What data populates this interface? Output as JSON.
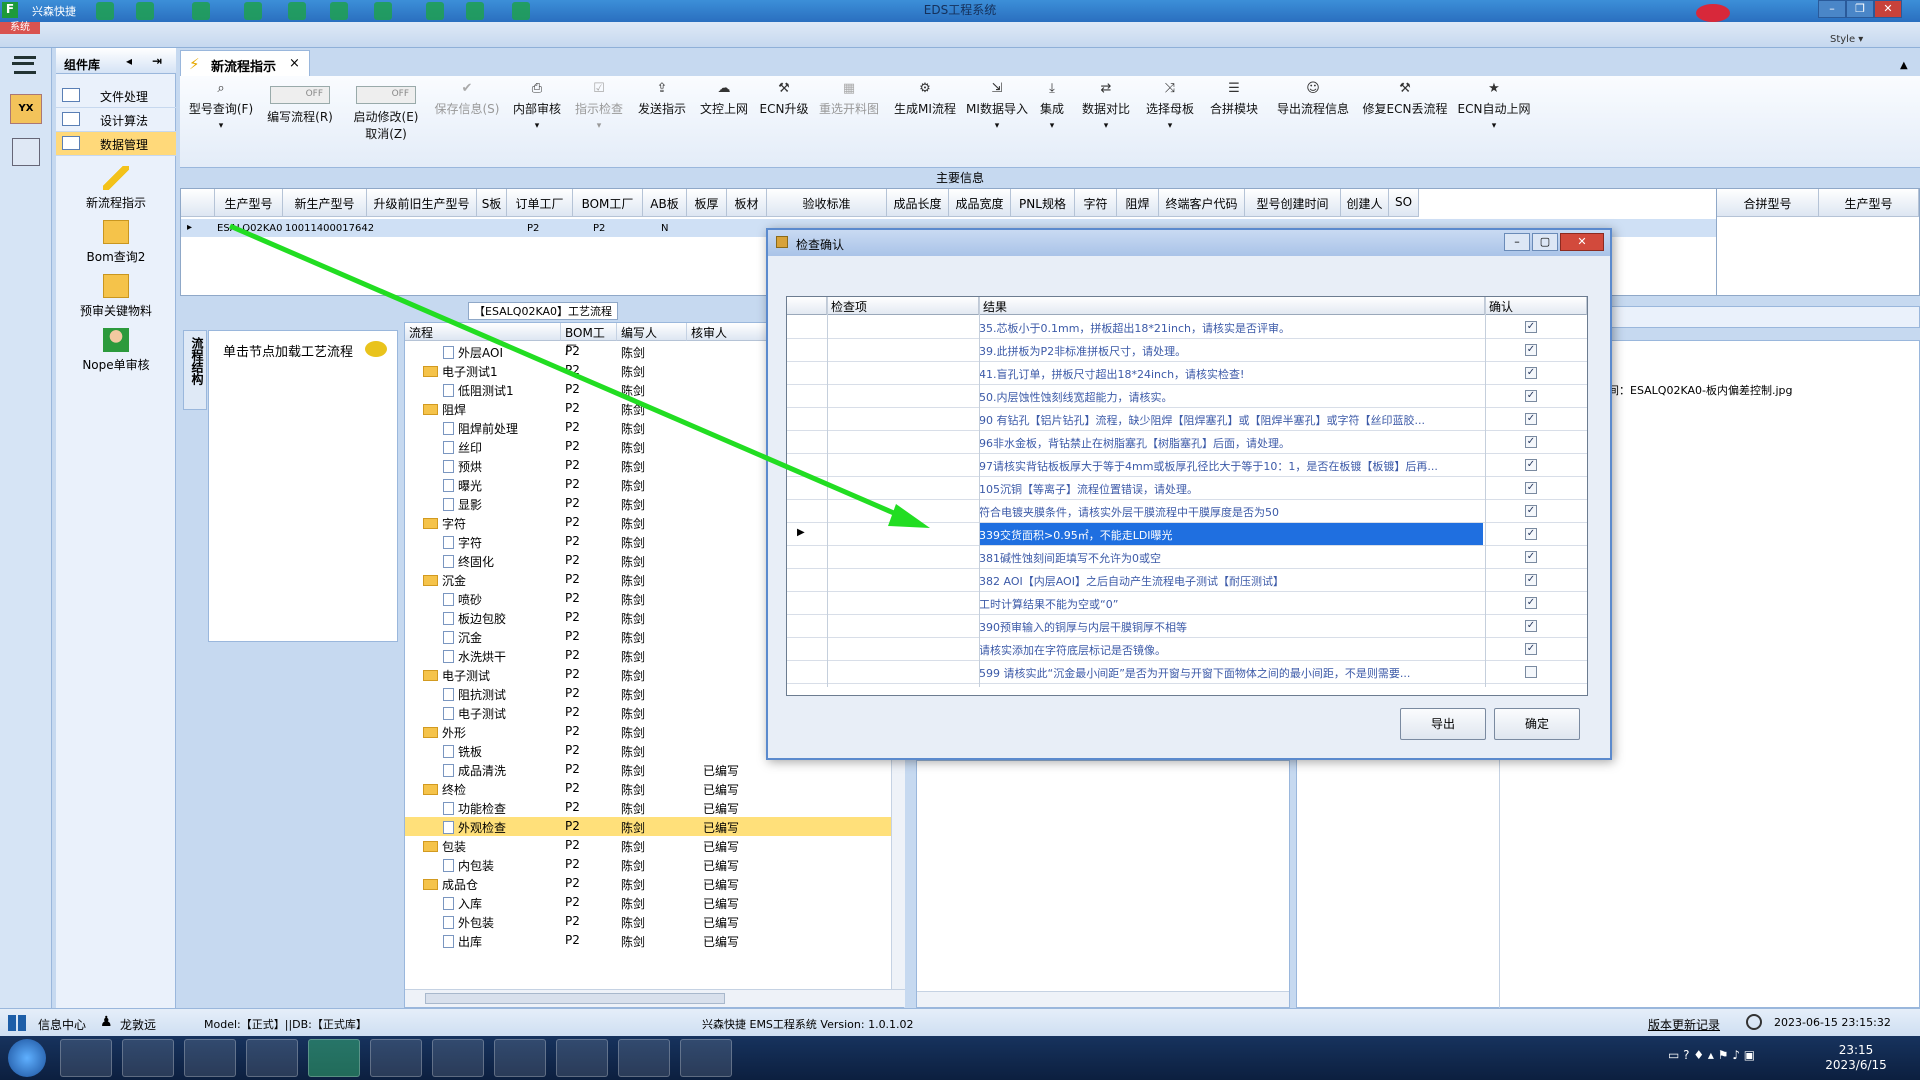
{
  "titlebar": {
    "app_name": "兴森快捷",
    "title": "EDS工程系统"
  },
  "sysbar": {
    "system_label": "系统",
    "style_label": "Style ▾"
  },
  "component_library": {
    "title": "组件库",
    "nav": [
      {
        "label": "文件处理"
      },
      {
        "label": "设计算法"
      },
      {
        "label": "数据管理"
      }
    ],
    "tools": [
      {
        "label": "新流程指示"
      },
      {
        "label": "Bom查询2"
      },
      {
        "label": "预审关键物料"
      },
      {
        "label": "Nope单审核"
      }
    ]
  },
  "doc_tab": {
    "label": "新流程指示"
  },
  "toolbar": {
    "items": [
      {
        "label": "型号查询(F)",
        "icon": "search-icon"
      },
      {
        "label": "编写流程(R)",
        "toggle": "OFF"
      },
      {
        "label": "启动修改(E)",
        "sub": "取消(Z)",
        "toggle": "OFF"
      },
      {
        "label": "保存信息(S)",
        "icon": "check-icon",
        "disabled": true
      },
      {
        "label": "内部审核",
        "icon": "print-icon"
      },
      {
        "label": "指示检查",
        "icon": "check-icon",
        "disabled": true
      },
      {
        "label": "发送指示",
        "icon": "upload-icon"
      },
      {
        "label": "文控上网",
        "icon": "cloud-icon"
      },
      {
        "label": "ECN升级",
        "icon": "wrench-icon"
      },
      {
        "label": "重选开料图",
        "icon": "image-icon",
        "disabled": true
      },
      {
        "label": "生成MI流程",
        "icon": "gear-icon"
      },
      {
        "label": "MI数据导入",
        "icon": "import-icon"
      },
      {
        "label": "集成",
        "icon": "download-icon"
      },
      {
        "label": "数据对比",
        "icon": "compare-icon"
      },
      {
        "label": "选择母板",
        "icon": "shuffle-icon"
      },
      {
        "label": "合拼模块",
        "icon": "list-icon"
      },
      {
        "label": "导出流程信息",
        "icon": "smile-icon"
      },
      {
        "label": "修复ECN丢流程",
        "icon": "hammer-icon"
      },
      {
        "label": "ECN自动上网",
        "icon": "star-icon"
      }
    ]
  },
  "main_info": {
    "title": "主要信息"
  },
  "top_grid": {
    "columns": [
      "生产型号",
      "新生产型号",
      "升级前旧生产型号",
      "S板",
      "订单工厂",
      "BOM工厂",
      "AB板",
      "板厚",
      "板材",
      "验收标准",
      "成品长度",
      "成品宽度",
      "PNL规格",
      "字符",
      "阻焊",
      "终端客户代码",
      "型号创建时间",
      "创建人",
      "SO"
    ],
    "row": {
      "prod_model": "ESALQ02KA0",
      "new_model": "10011400017642",
      "order_factory": "P2",
      "bom_factory": "P2",
      "ab": "N"
    }
  },
  "right_grid": {
    "columns": [
      "合拼型号",
      "生产型号"
    ]
  },
  "side_tab": {
    "label": "流程结构"
  },
  "node_panel": {
    "hint": "单击节点加载工艺流程"
  },
  "flow": {
    "title": "【ESALQ02KA0】工艺流程",
    "columns": [
      "流程",
      "BOM工厂",
      "编写人",
      "核审人",
      ""
    ],
    "rows": [
      {
        "name": "外层AOI",
        "level": 2,
        "bom": "P2",
        "writer": "陈剑",
        "status": ""
      },
      {
        "name": "电子测试1",
        "level": 1,
        "bom": "P2",
        "writer": "陈剑",
        "status": ""
      },
      {
        "name": "低阻测试1",
        "level": 2,
        "bom": "P2",
        "writer": "陈剑",
        "status": ""
      },
      {
        "name": "阻焊",
        "level": 1,
        "bom": "P2",
        "writer": "陈剑",
        "status": ""
      },
      {
        "name": "阻焊前处理",
        "level": 2,
        "bom": "P2",
        "writer": "陈剑",
        "status": ""
      },
      {
        "name": "丝印",
        "level": 2,
        "bom": "P2",
        "writer": "陈剑",
        "status": ""
      },
      {
        "name": "预烘",
        "level": 2,
        "bom": "P2",
        "writer": "陈剑",
        "status": ""
      },
      {
        "name": "曝光",
        "level": 2,
        "bom": "P2",
        "writer": "陈剑",
        "status": ""
      },
      {
        "name": "显影",
        "level": 2,
        "bom": "P2",
        "writer": "陈剑",
        "status": ""
      },
      {
        "name": "字符",
        "level": 1,
        "bom": "P2",
        "writer": "陈剑",
        "status": ""
      },
      {
        "name": "字符",
        "level": 2,
        "bom": "P2",
        "writer": "陈剑",
        "status": ""
      },
      {
        "name": "终固化",
        "level": 2,
        "bom": "P2",
        "writer": "陈剑",
        "status": ""
      },
      {
        "name": "沉金",
        "level": 1,
        "bom": "P2",
        "writer": "陈剑",
        "status": ""
      },
      {
        "name": "喷砂",
        "level": 2,
        "bom": "P2",
        "writer": "陈剑",
        "status": ""
      },
      {
        "name": "板边包胶",
        "level": 2,
        "bom": "P2",
        "writer": "陈剑",
        "status": ""
      },
      {
        "name": "沉金",
        "level": 2,
        "bom": "P2",
        "writer": "陈剑",
        "status": ""
      },
      {
        "name": "水洗烘干",
        "level": 2,
        "bom": "P2",
        "writer": "陈剑",
        "status": ""
      },
      {
        "name": "电子测试",
        "level": 1,
        "bom": "P2",
        "writer": "陈剑",
        "status": ""
      },
      {
        "name": "阻抗测试",
        "level": 2,
        "bom": "P2",
        "writer": "陈剑",
        "status": ""
      },
      {
        "name": "电子测试",
        "level": 2,
        "bom": "P2",
        "writer": "陈剑",
        "status": ""
      },
      {
        "name": "外形",
        "level": 1,
        "bom": "P2",
        "writer": "陈剑",
        "status": ""
      },
      {
        "name": "铣板",
        "level": 2,
        "bom": "P2",
        "writer": "陈剑",
        "status": ""
      },
      {
        "name": "成品清洗",
        "level": 2,
        "bom": "P2",
        "writer": "陈剑",
        "status": "已编写"
      },
      {
        "name": "终检",
        "level": 1,
        "bom": "P2",
        "writer": "陈剑",
        "status": "已编写"
      },
      {
        "name": "功能检查",
        "level": 2,
        "bom": "P2",
        "writer": "陈剑",
        "status": "已编写"
      },
      {
        "name": "外观检查",
        "level": 2,
        "bom": "P2",
        "writer": "陈剑",
        "status": "已编写",
        "selected": true
      },
      {
        "name": "包装",
        "level": 1,
        "bom": "P2",
        "writer": "陈剑",
        "status": "已编写"
      },
      {
        "name": "内包装",
        "level": 2,
        "bom": "P2",
        "writer": "陈剑",
        "status": "已编写"
      },
      {
        "name": "成品仓",
        "level": 1,
        "bom": "P2",
        "writer": "陈剑",
        "status": "已编写"
      },
      {
        "name": "入库",
        "level": 2,
        "bom": "P2",
        "writer": "陈剑",
        "status": "已编写"
      },
      {
        "name": "外包装",
        "level": 2,
        "bom": "P2",
        "writer": "陈剑",
        "status": "已编写"
      },
      {
        "name": "出库",
        "level": 2,
        "bom": "P2",
        "writer": "陈剑",
        "status": "已编写"
      }
    ]
  },
  "right_panel": {
    "filename": "间：ESALQ02KA0-板内偏差控制.jpg"
  },
  "dialog": {
    "title": "检查确认",
    "columns": [
      "检查项",
      "结果",
      "确认"
    ],
    "rows": [
      {
        "result": "35.芯板小于0.1mm，拼板超出18*21inch，请核实是否评审。",
        "checked": true
      },
      {
        "result": "39.此拼板为P2非标准拼板尺寸，请处理。",
        "checked": true
      },
      {
        "result": "41.盲孔订单，拼板尺寸超出18*24inch，请核实检查!",
        "checked": true
      },
      {
        "result": "50.内层蚀性蚀刻线宽超能力，请核实。",
        "checked": true
      },
      {
        "result": "90 有钻孔【铝片钻孔】流程，缺少阻焊【阻焊塞孔】或【阻焊半塞孔】或字符【丝印蓝胶...",
        "checked": true
      },
      {
        "result": "96非水金板，背钻禁止在树脂塞孔【树脂塞孔】后面，请处理。",
        "checked": true
      },
      {
        "result": "97请核实背钻板板厚大于等于4mm或板厚孔径比大于等于10：1，是否在板镀【板镀】后再...",
        "checked": true
      },
      {
        "result": "105沉铜【等离子】流程位置错误，请处理。",
        "checked": true
      },
      {
        "result": "符合电镀夹膜条件，请核实外层干膜流程中干膜厚度是否为50",
        "checked": true
      },
      {
        "result": "339交货面积>0.95㎡，不能走LDI曝光",
        "checked": true,
        "selected": true
      },
      {
        "result": "381碱性蚀刻间距填写不允许为0或空",
        "checked": true
      },
      {
        "result": "382 AOI【内层AOI】之后自动产生流程电子测试【耐压测试】",
        "checked": true
      },
      {
        "result": "工时计算结果不能为空或“0”",
        "checked": true
      },
      {
        "result": "390预审输入的铜厚与内层干膜铜厚不相等",
        "checked": true
      },
      {
        "result": "请核实添加在字符底层标记是否镜像。",
        "checked": true
      },
      {
        "result": "599 请核实此“沉金最小间距”是否为开窗与开窗下面物体之间的最小间距，不是则需要...",
        "checked": false
      }
    ],
    "export_label": "导出",
    "ok_label": "确定"
  },
  "status": {
    "info_center": "信息中心",
    "user": "龙敦远",
    "model_db": "Model:【正式】||DB:【正式库】",
    "version": "兴森快捷 EMS工程系统 Version: 1.0.1.02",
    "update_log": "版本更新记录",
    "datetime": "2023-06-15 23:15:32"
  },
  "taskbar": {
    "time": "23:15",
    "date": "2023/6/15"
  },
  "colors": {
    "accent": "#1f6fe0",
    "selected_row": "#ffe07a",
    "arrow": "#22dd22"
  }
}
